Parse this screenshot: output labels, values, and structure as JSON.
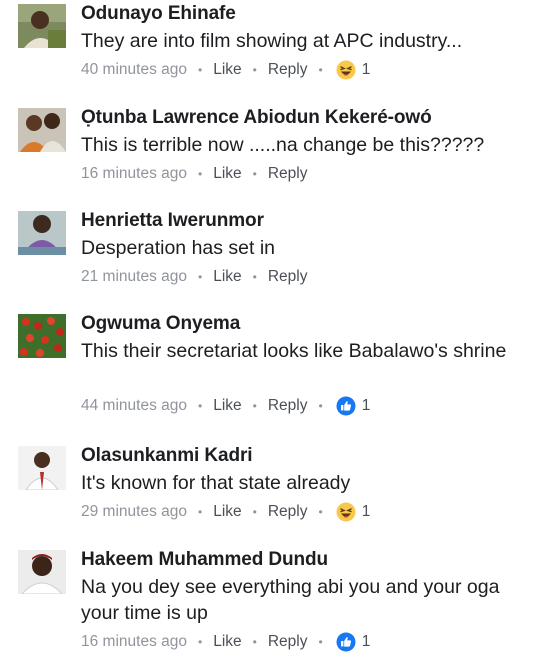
{
  "comments": [
    {
      "author": "Odunayo Ehinafe",
      "text": "They are into film showing at APC industry...",
      "time": "40 minutes ago",
      "like": "Like",
      "reply": "Reply",
      "reaction": "haha-icon",
      "reaction_count": "1"
    },
    {
      "author": "Ọtunba Lawrence Abiodun Kekeré-owó",
      "text": "This is terrible now .....na change be this?????",
      "time": "16 minutes ago",
      "like": "Like",
      "reply": "Reply"
    },
    {
      "author": "Henrietta Iwerunmor",
      "text": "Desperation has set in",
      "time": "21 minutes ago",
      "like": "Like",
      "reply": "Reply"
    },
    {
      "author": "Ogwuma Onyema",
      "text": "This their secretariat looks like Babalawo's shrine",
      "time": "44 minutes ago",
      "like": "Like",
      "reply": "Reply",
      "reaction": "like-icon",
      "reaction_count": "1"
    },
    {
      "author": "Olasunkanmi Kadri",
      "text": "It's known for that state already",
      "time": "29 minutes ago",
      "like": "Like",
      "reply": "Reply",
      "reaction": "haha-icon",
      "reaction_count": "1"
    },
    {
      "author": "Hakeem Muhammed Dundu",
      "text": "Na you dey see everything abi you and your oga your time is up",
      "time": "16 minutes ago",
      "like": "Like",
      "reply": "Reply",
      "reaction": "like-icon",
      "reaction_count": "1"
    }
  ],
  "colors": {
    "name": "#1c1e21",
    "meta": "#90949c",
    "like_blue": "#1877f2",
    "haha_yellow": "#f7c84a"
  }
}
